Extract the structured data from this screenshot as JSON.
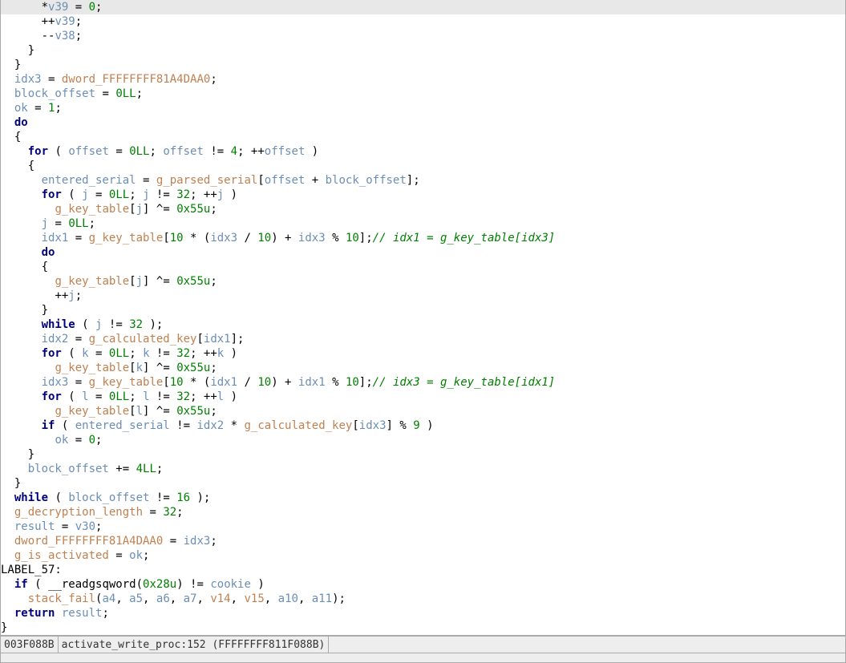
{
  "status": {
    "address": "003F088B",
    "function": "activate_write_proc:152 (FFFFFFFF811F088B)"
  },
  "code": {
    "lines": [
      {
        "hl": true,
        "ind": 6,
        "t": [
          [
            "op",
            "*"
          ],
          [
            "var",
            "v39"
          ],
          [
            "op",
            " = "
          ],
          [
            "num",
            "0"
          ],
          [
            "op",
            ";"
          ]
        ]
      },
      {
        "hl": false,
        "ind": 6,
        "t": [
          [
            "op",
            "++"
          ],
          [
            "var",
            "v39"
          ],
          [
            "op",
            ";"
          ]
        ]
      },
      {
        "hl": false,
        "ind": 6,
        "t": [
          [
            "op",
            "--"
          ],
          [
            "var",
            "v38"
          ],
          [
            "op",
            ";"
          ]
        ]
      },
      {
        "hl": false,
        "ind": 4,
        "t": [
          [
            "op",
            "}"
          ]
        ]
      },
      {
        "hl": false,
        "ind": 2,
        "t": [
          [
            "op",
            "}"
          ]
        ]
      },
      {
        "hl": false,
        "ind": 2,
        "t": [
          [
            "var",
            "idx3"
          ],
          [
            "op",
            " = "
          ],
          [
            "glob",
            "dword_FFFFFFFF81A4DAA0"
          ],
          [
            "op",
            ";"
          ]
        ]
      },
      {
        "hl": false,
        "ind": 2,
        "t": [
          [
            "var",
            "block_offset"
          ],
          [
            "op",
            " = "
          ],
          [
            "num",
            "0LL"
          ],
          [
            "op",
            ";"
          ]
        ]
      },
      {
        "hl": false,
        "ind": 2,
        "t": [
          [
            "var",
            "ok"
          ],
          [
            "op",
            " = "
          ],
          [
            "num",
            "1"
          ],
          [
            "op",
            ";"
          ]
        ]
      },
      {
        "hl": false,
        "ind": 2,
        "t": [
          [
            "kw",
            "do"
          ]
        ]
      },
      {
        "hl": false,
        "ind": 2,
        "t": [
          [
            "op",
            "{"
          ]
        ]
      },
      {
        "hl": false,
        "ind": 4,
        "t": [
          [
            "kw",
            "for"
          ],
          [
            "op",
            " ( "
          ],
          [
            "var",
            "offset"
          ],
          [
            "op",
            " = "
          ],
          [
            "num",
            "0LL"
          ],
          [
            "op",
            "; "
          ],
          [
            "var",
            "offset"
          ],
          [
            "op",
            " != "
          ],
          [
            "num",
            "4"
          ],
          [
            "op",
            "; ++"
          ],
          [
            "var",
            "offset"
          ],
          [
            "op",
            " )"
          ]
        ]
      },
      {
        "hl": false,
        "ind": 4,
        "t": [
          [
            "op",
            "{"
          ]
        ]
      },
      {
        "hl": false,
        "ind": 6,
        "t": [
          [
            "var",
            "entered_serial"
          ],
          [
            "op",
            " = "
          ],
          [
            "glob",
            "g_parsed_serial"
          ],
          [
            "op",
            "["
          ],
          [
            "var",
            "offset"
          ],
          [
            "op",
            " + "
          ],
          [
            "var",
            "block_offset"
          ],
          [
            "op",
            "];"
          ]
        ]
      },
      {
        "hl": false,
        "ind": 6,
        "t": [
          [
            "kw",
            "for"
          ],
          [
            "op",
            " ( "
          ],
          [
            "var",
            "j"
          ],
          [
            "op",
            " = "
          ],
          [
            "num",
            "0LL"
          ],
          [
            "op",
            "; "
          ],
          [
            "var",
            "j"
          ],
          [
            "op",
            " != "
          ],
          [
            "num",
            "32"
          ],
          [
            "op",
            "; ++"
          ],
          [
            "var",
            "j"
          ],
          [
            "op",
            " )"
          ]
        ]
      },
      {
        "hl": false,
        "ind": 8,
        "t": [
          [
            "glob",
            "g_key_table"
          ],
          [
            "op",
            "["
          ],
          [
            "var",
            "j"
          ],
          [
            "op",
            "] ^= "
          ],
          [
            "num",
            "0x55u"
          ],
          [
            "op",
            ";"
          ]
        ]
      },
      {
        "hl": false,
        "ind": 6,
        "t": [
          [
            "var",
            "j"
          ],
          [
            "op",
            " = "
          ],
          [
            "num",
            "0LL"
          ],
          [
            "op",
            ";"
          ]
        ]
      },
      {
        "hl": false,
        "ind": 6,
        "t": [
          [
            "var",
            "idx1"
          ],
          [
            "op",
            " = "
          ],
          [
            "glob",
            "g_key_table"
          ],
          [
            "op",
            "["
          ],
          [
            "num",
            "10"
          ],
          [
            "op",
            " * ("
          ],
          [
            "var",
            "idx3"
          ],
          [
            "op",
            " / "
          ],
          [
            "num",
            "10"
          ],
          [
            "op",
            ") + "
          ],
          [
            "var",
            "idx3"
          ],
          [
            "op",
            " % "
          ],
          [
            "num",
            "10"
          ],
          [
            "op",
            "];"
          ],
          [
            "cmt",
            "// idx1 = g_key_table[idx3]"
          ]
        ]
      },
      {
        "hl": false,
        "ind": 6,
        "t": [
          [
            "kw",
            "do"
          ]
        ]
      },
      {
        "hl": false,
        "ind": 6,
        "t": [
          [
            "op",
            "{"
          ]
        ]
      },
      {
        "hl": false,
        "ind": 8,
        "t": [
          [
            "glob",
            "g_key_table"
          ],
          [
            "op",
            "["
          ],
          [
            "var",
            "j"
          ],
          [
            "op",
            "] ^= "
          ],
          [
            "num",
            "0x55u"
          ],
          [
            "op",
            ";"
          ]
        ]
      },
      {
        "hl": false,
        "ind": 8,
        "t": [
          [
            "op",
            "++"
          ],
          [
            "var",
            "j"
          ],
          [
            "op",
            ";"
          ]
        ]
      },
      {
        "hl": false,
        "ind": 6,
        "t": [
          [
            "op",
            "}"
          ]
        ]
      },
      {
        "hl": false,
        "ind": 6,
        "t": [
          [
            "kw",
            "while"
          ],
          [
            "op",
            " ( "
          ],
          [
            "var",
            "j"
          ],
          [
            "op",
            " != "
          ],
          [
            "num",
            "32"
          ],
          [
            "op",
            " );"
          ]
        ]
      },
      {
        "hl": false,
        "ind": 6,
        "t": [
          [
            "var",
            "idx2"
          ],
          [
            "op",
            " = "
          ],
          [
            "glob",
            "g_calculated_key"
          ],
          [
            "op",
            "["
          ],
          [
            "var",
            "idx1"
          ],
          [
            "op",
            "];"
          ]
        ]
      },
      {
        "hl": false,
        "ind": 6,
        "t": [
          [
            "kw",
            "for"
          ],
          [
            "op",
            " ( "
          ],
          [
            "var",
            "k"
          ],
          [
            "op",
            " = "
          ],
          [
            "num",
            "0LL"
          ],
          [
            "op",
            "; "
          ],
          [
            "var",
            "k"
          ],
          [
            "op",
            " != "
          ],
          [
            "num",
            "32"
          ],
          [
            "op",
            "; ++"
          ],
          [
            "var",
            "k"
          ],
          [
            "op",
            " )"
          ]
        ]
      },
      {
        "hl": false,
        "ind": 8,
        "t": [
          [
            "glob",
            "g_key_table"
          ],
          [
            "op",
            "["
          ],
          [
            "var",
            "k"
          ],
          [
            "op",
            "] ^= "
          ],
          [
            "num",
            "0x55u"
          ],
          [
            "op",
            ";"
          ]
        ]
      },
      {
        "hl": false,
        "ind": 6,
        "t": [
          [
            "var",
            "idx3"
          ],
          [
            "op",
            " = "
          ],
          [
            "glob",
            "g_key_table"
          ],
          [
            "op",
            "["
          ],
          [
            "num",
            "10"
          ],
          [
            "op",
            " * ("
          ],
          [
            "var",
            "idx1"
          ],
          [
            "op",
            " / "
          ],
          [
            "num",
            "10"
          ],
          [
            "op",
            ") + "
          ],
          [
            "var",
            "idx1"
          ],
          [
            "op",
            " % "
          ],
          [
            "num",
            "10"
          ],
          [
            "op",
            "];"
          ],
          [
            "cmt",
            "// idx3 = g_key_table[idx1]"
          ]
        ]
      },
      {
        "hl": false,
        "ind": 6,
        "t": [
          [
            "kw",
            "for"
          ],
          [
            "op",
            " ( "
          ],
          [
            "var",
            "l"
          ],
          [
            "op",
            " = "
          ],
          [
            "num",
            "0LL"
          ],
          [
            "op",
            "; "
          ],
          [
            "var",
            "l"
          ],
          [
            "op",
            " != "
          ],
          [
            "num",
            "32"
          ],
          [
            "op",
            "; ++"
          ],
          [
            "var",
            "l"
          ],
          [
            "op",
            " )"
          ]
        ]
      },
      {
        "hl": false,
        "ind": 8,
        "t": [
          [
            "glob",
            "g_key_table"
          ],
          [
            "op",
            "["
          ],
          [
            "var",
            "l"
          ],
          [
            "op",
            "] ^= "
          ],
          [
            "num",
            "0x55u"
          ],
          [
            "op",
            ";"
          ]
        ]
      },
      {
        "hl": false,
        "ind": 6,
        "t": [
          [
            "kw",
            "if"
          ],
          [
            "op",
            " ( "
          ],
          [
            "var",
            "entered_serial"
          ],
          [
            "op",
            " != "
          ],
          [
            "var",
            "idx2"
          ],
          [
            "op",
            " * "
          ],
          [
            "glob",
            "g_calculated_key"
          ],
          [
            "op",
            "["
          ],
          [
            "var",
            "idx3"
          ],
          [
            "op",
            "] % "
          ],
          [
            "num",
            "9"
          ],
          [
            "op",
            " )"
          ]
        ]
      },
      {
        "hl": false,
        "ind": 8,
        "t": [
          [
            "var",
            "ok"
          ],
          [
            "op",
            " = "
          ],
          [
            "num",
            "0"
          ],
          [
            "op",
            ";"
          ]
        ]
      },
      {
        "hl": false,
        "ind": 4,
        "t": [
          [
            "op",
            "}"
          ]
        ]
      },
      {
        "hl": false,
        "ind": 4,
        "t": [
          [
            "var",
            "block_offset"
          ],
          [
            "op",
            " += "
          ],
          [
            "num",
            "4LL"
          ],
          [
            "op",
            ";"
          ]
        ]
      },
      {
        "hl": false,
        "ind": 2,
        "t": [
          [
            "op",
            "}"
          ]
        ]
      },
      {
        "hl": false,
        "ind": 2,
        "t": [
          [
            "kw",
            "while"
          ],
          [
            "op",
            " ( "
          ],
          [
            "var",
            "block_offset"
          ],
          [
            "op",
            " != "
          ],
          [
            "num",
            "16"
          ],
          [
            "op",
            " );"
          ]
        ]
      },
      {
        "hl": false,
        "ind": 2,
        "t": [
          [
            "glob",
            "g_decryption_length"
          ],
          [
            "op",
            " = "
          ],
          [
            "num",
            "32"
          ],
          [
            "op",
            ";"
          ]
        ]
      },
      {
        "hl": false,
        "ind": 2,
        "t": [
          [
            "var",
            "result"
          ],
          [
            "op",
            " = "
          ],
          [
            "var",
            "v30"
          ],
          [
            "op",
            ";"
          ]
        ]
      },
      {
        "hl": false,
        "ind": 2,
        "t": [
          [
            "glob",
            "dword_FFFFFFFF81A4DAA0"
          ],
          [
            "op",
            " = "
          ],
          [
            "var",
            "idx3"
          ],
          [
            "op",
            ";"
          ]
        ]
      },
      {
        "hl": false,
        "ind": 2,
        "t": [
          [
            "glob",
            "g_is_activated"
          ],
          [
            "op",
            " = "
          ],
          [
            "var",
            "ok"
          ],
          [
            "op",
            ";"
          ]
        ]
      },
      {
        "hl": false,
        "ind": 0,
        "t": [
          [
            "lbl",
            "LABEL_57:"
          ]
        ]
      },
      {
        "hl": false,
        "ind": 2,
        "t": [
          [
            "kw",
            "if"
          ],
          [
            "op",
            " ( "
          ],
          [
            "plain",
            "__readgsqword"
          ],
          [
            "op",
            "("
          ],
          [
            "num",
            "0x28u"
          ],
          [
            "op",
            ") != "
          ],
          [
            "var",
            "cookie"
          ],
          [
            "op",
            " )"
          ]
        ]
      },
      {
        "hl": false,
        "ind": 4,
        "t": [
          [
            "glob",
            "stack_fail"
          ],
          [
            "op",
            "("
          ],
          [
            "var",
            "a4"
          ],
          [
            "op",
            ", "
          ],
          [
            "var",
            "a5"
          ],
          [
            "op",
            ", "
          ],
          [
            "var",
            "a6"
          ],
          [
            "op",
            ", "
          ],
          [
            "var",
            "a7"
          ],
          [
            "op",
            ", "
          ],
          [
            "glob",
            "v14"
          ],
          [
            "op",
            ", "
          ],
          [
            "glob",
            "v15"
          ],
          [
            "op",
            ", "
          ],
          [
            "var",
            "a10"
          ],
          [
            "op",
            ", "
          ],
          [
            "var",
            "a11"
          ],
          [
            "op",
            ");"
          ]
        ]
      },
      {
        "hl": false,
        "ind": 2,
        "t": [
          [
            "kw",
            "return"
          ],
          [
            "op",
            " "
          ],
          [
            "var",
            "result"
          ],
          [
            "op",
            ";"
          ]
        ]
      },
      {
        "hl": false,
        "ind": 0,
        "t": [
          [
            "op",
            "}"
          ]
        ]
      }
    ]
  }
}
